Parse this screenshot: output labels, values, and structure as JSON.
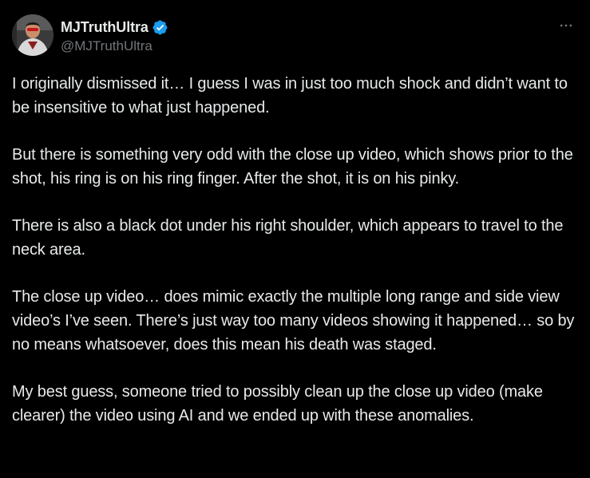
{
  "author": {
    "display_name": "MJTruthUltra",
    "handle": "@MJTruthUltra",
    "verified": true,
    "verified_icon": "verified-badge-icon",
    "avatar_icon": "profile-avatar"
  },
  "menu": {
    "more_icon": "more-horizontal-icon"
  },
  "tweet": {
    "paragraphs": [
      "I originally dismissed it… I guess I was in just too much shock and didn’t want to be insensitive to what just happened.",
      "But there is something very odd with the close up video, which shows prior to the shot, his ring is on his ring finger. After the shot, it is on his pinky.",
      "There is also a black dot under his right shoulder, which appears to travel to the neck area.",
      "The close up video… does mimic exactly the multiple long range and side view video’s I’ve seen. There’s just way too many videos showing it happened… so by no means whatsoever, does this mean his death was staged.",
      "My best guess, someone tried to possibly clean up the close up video (make clearer) the video using AI and we ended up with these anomalies."
    ]
  },
  "colors": {
    "background": "#000000",
    "text_primary": "#e7e9ea",
    "text_secondary": "#71767b",
    "verified_blue": "#1d9bf0"
  }
}
